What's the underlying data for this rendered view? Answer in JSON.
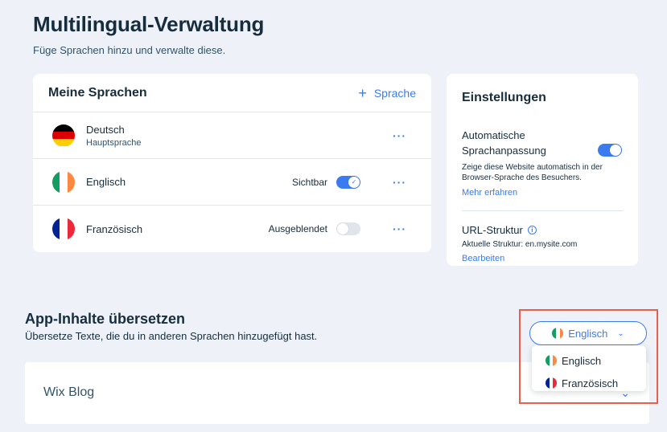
{
  "page": {
    "title": "Multilingual-Verwaltung",
    "subtitle": "Füge Sprachen hinzu und verwalte diese."
  },
  "languages_card": {
    "title": "Meine Sprachen",
    "add_label": "Sprache",
    "rows": [
      {
        "name": "Deutsch",
        "sub": "Hauptsprache",
        "flag_colors": [
          "#000000",
          "#dd0000",
          "#ffce00"
        ]
      },
      {
        "name": "Englisch",
        "status": "Sichtbar",
        "visible": true,
        "flag_colors": [
          "#169b62",
          "#ffffff",
          "#ff883e"
        ]
      },
      {
        "name": "Französisch",
        "status": "Ausgeblendet",
        "visible": false,
        "flag_colors": [
          "#002395",
          "#ffffff",
          "#ed2939"
        ]
      }
    ],
    "more_icon": "ellipsis-icon"
  },
  "settings_card": {
    "title": "Einstellungen",
    "auto_label": "Automatische Sprachanpassung",
    "auto_enabled": true,
    "auto_desc": "Zeige diese Website automatisch in der Browser-Sprache des Besuchers.",
    "auto_link": "Mehr erfahren",
    "url_label": "URL-Struktur",
    "url_desc": "Aktuelle Struktur: en.mysite.com",
    "url_link": "Bearbeiten"
  },
  "app_content": {
    "title": "App-Inhalte übersetzen",
    "subtitle": "Übersetze Texte, die du in anderen Sprachen hinzugefügt hast.",
    "apps": [
      {
        "name": "Wix Blog"
      }
    ]
  },
  "language_selector": {
    "selected": "Englisch",
    "options": [
      {
        "label": "Englisch",
        "flag_colors": [
          "#169b62",
          "#ffffff",
          "#ff883e"
        ]
      },
      {
        "label": "Französisch",
        "flag_colors": [
          "#002395",
          "#ffffff",
          "#ed2939"
        ]
      }
    ]
  },
  "colors": {
    "accent": "#3b7bf0",
    "text": "#162d3d",
    "background": "#eef2f8",
    "highlight": "#e8604a"
  }
}
